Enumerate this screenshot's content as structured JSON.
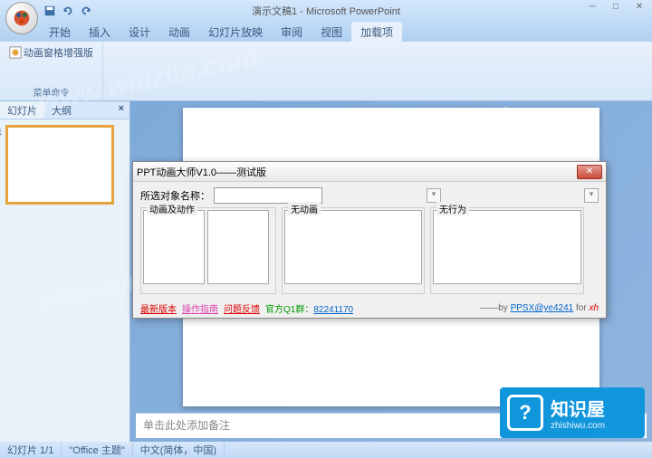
{
  "window": {
    "title": "演示文稿1 - Microsoft PowerPoint"
  },
  "ribbon": {
    "tabs": [
      "开始",
      "插入",
      "设计",
      "动画",
      "幻灯片放映",
      "审阅",
      "视图",
      "加载项"
    ],
    "active_tab": "加载项",
    "group1_btn": "动画窗格增强版",
    "group1_label": "菜单命令"
  },
  "sidepanel": {
    "tab_slides": "幻灯片",
    "tab_outline": "大纲",
    "slide_number": "1"
  },
  "notes": {
    "placeholder": "单击此处添加备注"
  },
  "statusbar": {
    "slide": "幻灯片 1/1",
    "theme": "\"Office 主题\"",
    "lang": "中文(简体，中国)"
  },
  "dialog": {
    "title": "PPT动画大师V1.0——测试版",
    "label_object": "所选对象名称：",
    "fs1": "动画及动作",
    "fs2": "无动画",
    "fs3": "无行为",
    "footer": {
      "l1": "最新版本",
      "l2": "操作指南",
      "l3": "问题反馈",
      "l4_pre": "官方Q1群：",
      "l4_num": "82241170",
      "by": "——by",
      "email": "PPSX@ye4241",
      "for": "for",
      "xh": "xh"
    }
  },
  "watermark": "www.wmzhe.com",
  "logo": {
    "cn": "知识屋",
    "url": "zhishiwu.com"
  }
}
